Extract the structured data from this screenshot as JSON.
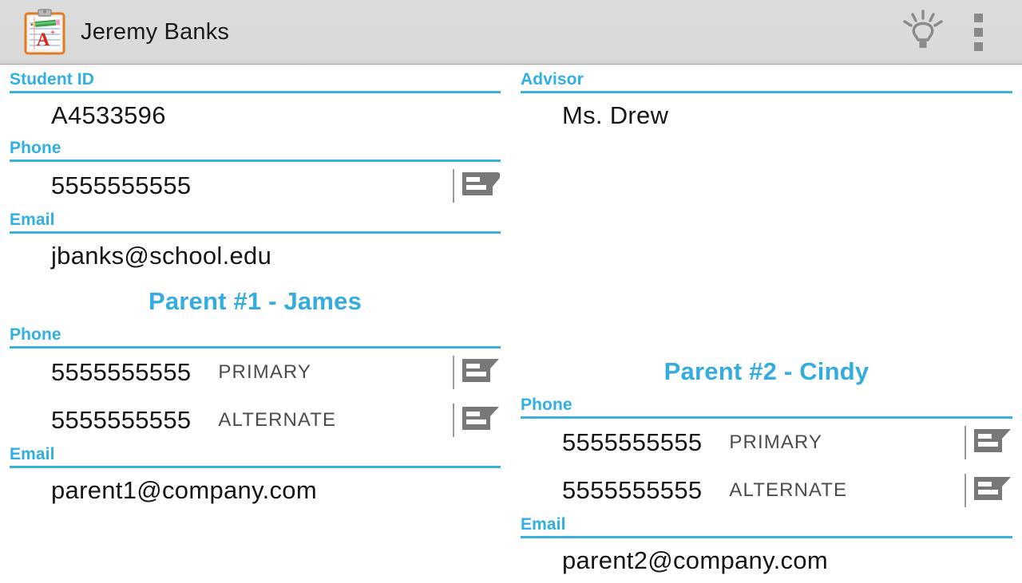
{
  "app": {
    "title": "Jeremy Banks",
    "icon": "clipboard-grade-icon",
    "hint_icon": "lightbulb-icon",
    "overflow_icon": "overflow-menu-icon",
    "accent_color": "#2fafe2",
    "bar_color": "#d9d9d9"
  },
  "student": {
    "id_label": "Student ID",
    "id_value": "A4533596",
    "phone_label": "Phone",
    "phone_value": "5555555555",
    "email_label": "Email",
    "email_value": "jbanks@school.edu"
  },
  "advisor": {
    "label": "Advisor",
    "value": "Ms. Drew"
  },
  "parent1": {
    "heading": "Parent #1 - James",
    "phone_label": "Phone",
    "phones": [
      {
        "number": "5555555555",
        "kind": "PRIMARY",
        "action_icon": "message-icon"
      },
      {
        "number": "5555555555",
        "kind": "ALTERNATE",
        "action_icon": "message-icon"
      }
    ],
    "email_label": "Email",
    "email_value": "parent1@company.com"
  },
  "parent2": {
    "heading": "Parent #2 - Cindy",
    "phone_label": "Phone",
    "phones": [
      {
        "number": "5555555555",
        "kind": "PRIMARY",
        "action_icon": "message-icon"
      },
      {
        "number": "5555555555",
        "kind": "ALTERNATE",
        "action_icon": "message-icon"
      }
    ],
    "email_label": "Email",
    "email_value": "parent2@company.com"
  }
}
